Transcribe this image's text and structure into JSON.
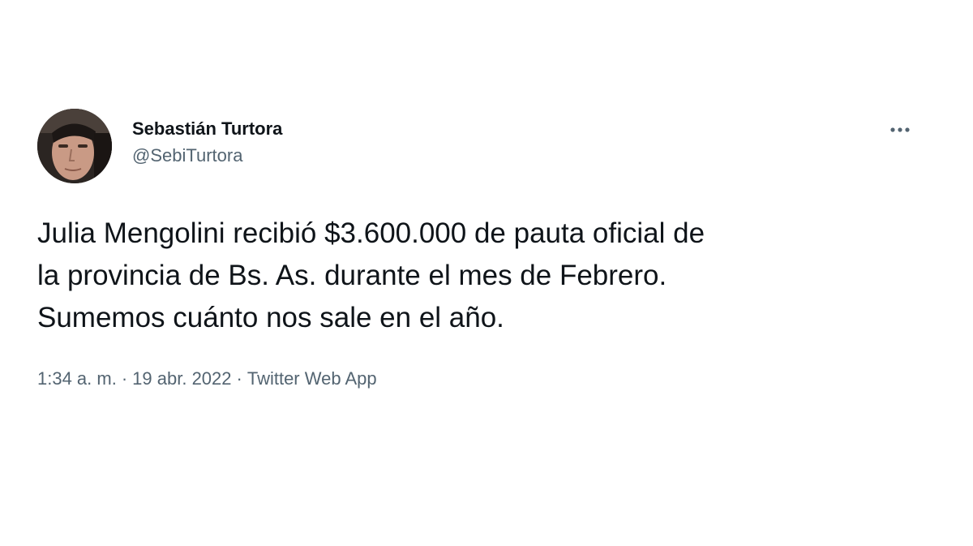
{
  "tweet": {
    "author": {
      "display_name": "Sebastián Turtora",
      "handle": "@SebiTurtora",
      "avatar_icon": "profile-photo"
    },
    "more_icon": "more-horizontal-icon",
    "text_lines": [
      "Julia Mengolini recibió $3.600.000 de pauta oficial de",
      "la provincia de Bs. As. durante el mes de Febrero.",
      "Sumemos cuánto nos sale en el año."
    ],
    "meta": {
      "time": "1:34 a. m.",
      "separator": "·",
      "date": "19 abr. 2022",
      "source": "Twitter Web App"
    }
  },
  "colors": {
    "text_primary": "#0f1419",
    "text_secondary": "#536471",
    "background": "#ffffff"
  }
}
